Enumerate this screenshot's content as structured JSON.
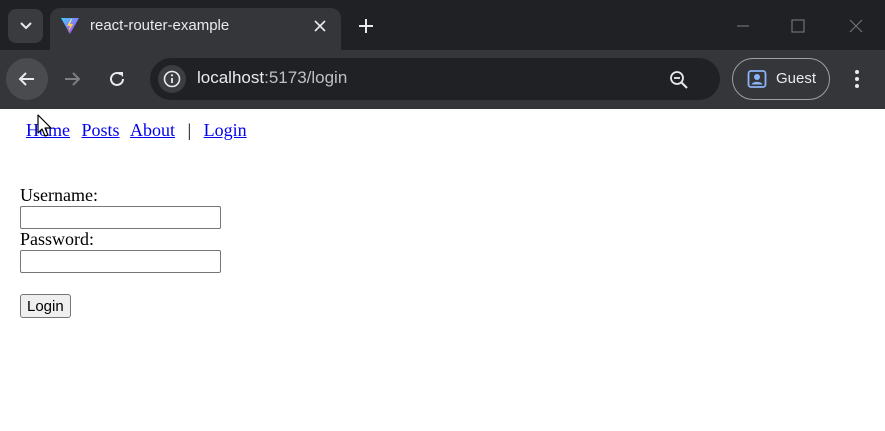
{
  "browser": {
    "tab": {
      "title": "react-router-example",
      "favicon": "vite-logo-icon"
    },
    "omnibox": {
      "host": "localhost",
      "path": ":5173/login"
    },
    "profile": {
      "label": "Guest"
    },
    "colors": {
      "frame": "#202124",
      "toolbar": "#35363a",
      "text": "#e8eaed"
    }
  },
  "page": {
    "nav": {
      "home": "Home",
      "posts": "Posts",
      "about": "About",
      "separator": "|",
      "login": "Login"
    },
    "form": {
      "username_label": "Username:",
      "username_value": "",
      "password_label": "Password:",
      "password_value": "",
      "submit_label": "Login"
    },
    "link_color": "#0000ee"
  }
}
